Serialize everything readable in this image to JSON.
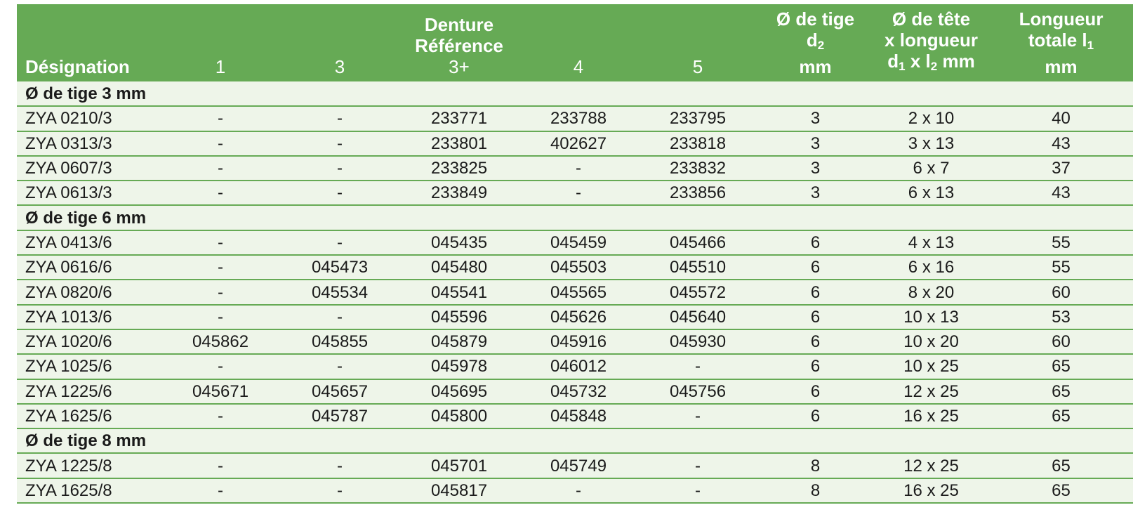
{
  "header": {
    "designation": "Désignation",
    "col1": "1",
    "col3": "3",
    "denture_line1": "Denture",
    "denture_line2": "Référence",
    "col3plus": "3+",
    "col4": "4",
    "col5": "5",
    "tige_line1": "Ø de tige",
    "tige_line2_base": "d",
    "tige_line2_sub": "2",
    "tige_line3": "mm",
    "tete_line1": "Ø de tête",
    "tete_line2": "x longueur",
    "tete_line3_d": "d",
    "tete_line3_d_sub": "1",
    "tete_line3_x": " x l",
    "tete_line3_l_sub": "2",
    "tete_line3_mm": " mm",
    "longueur_line1": "Longueur",
    "longueur_line2_base": "totale l",
    "longueur_line2_sub": "1",
    "longueur_line3": "mm"
  },
  "groups": [
    {
      "label": "Ø de tige 3 mm",
      "rows": [
        {
          "des": "ZYA 0210/3",
          "c1": "-",
          "c3": "-",
          "c3p": "233771",
          "c4": "233788",
          "c5": "233795",
          "d2": "3",
          "tete": "2 x 10",
          "long": "40"
        },
        {
          "des": "ZYA 0313/3",
          "c1": "-",
          "c3": "-",
          "c3p": "233801",
          "c4": "402627",
          "c5": "233818",
          "d2": "3",
          "tete": "3 x 13",
          "long": "43"
        },
        {
          "des": "ZYA 0607/3",
          "c1": "-",
          "c3": "-",
          "c3p": "233825",
          "c4": "-",
          "c5": "233832",
          "d2": "3",
          "tete": "6 x 7",
          "long": "37"
        },
        {
          "des": "ZYA 0613/3",
          "c1": "-",
          "c3": "-",
          "c3p": "233849",
          "c4": "-",
          "c5": "233856",
          "d2": "3",
          "tete": "6 x 13",
          "long": "43"
        }
      ]
    },
    {
      "label": "Ø de tige 6 mm",
      "rows": [
        {
          "des": "ZYA 0413/6",
          "c1": "-",
          "c3": "-",
          "c3p": "045435",
          "c4": "045459",
          "c5": "045466",
          "d2": "6",
          "tete": "4 x 13",
          "long": "55"
        },
        {
          "des": "ZYA 0616/6",
          "c1": "-",
          "c3": "045473",
          "c3p": "045480",
          "c4": "045503",
          "c5": "045510",
          "d2": "6",
          "tete": "6 x 16",
          "long": "55"
        },
        {
          "des": "ZYA 0820/6",
          "c1": "-",
          "c3": "045534",
          "c3p": "045541",
          "c4": "045565",
          "c5": "045572",
          "d2": "6",
          "tete": "8 x 20",
          "long": "60"
        },
        {
          "des": "ZYA 1013/6",
          "c1": "-",
          "c3": "-",
          "c3p": "045596",
          "c4": "045626",
          "c5": "045640",
          "d2": "6",
          "tete": "10 x 13",
          "long": "53"
        },
        {
          "des": "ZYA 1020/6",
          "c1": "045862",
          "c3": "045855",
          "c3p": "045879",
          "c4": "045916",
          "c5": "045930",
          "d2": "6",
          "tete": "10 x 20",
          "long": "60"
        },
        {
          "des": "ZYA 1025/6",
          "c1": "-",
          "c3": "-",
          "c3p": "045978",
          "c4": "046012",
          "c5": "-",
          "d2": "6",
          "tete": "10 x 25",
          "long": "65"
        },
        {
          "des": "ZYA 1225/6",
          "c1": "045671",
          "c3": "045657",
          "c3p": "045695",
          "c4": "045732",
          "c5": "045756",
          "d2": "6",
          "tete": "12 x 25",
          "long": "65"
        },
        {
          "des": "ZYA 1625/6",
          "c1": "-",
          "c3": "045787",
          "c3p": "045800",
          "c4": "045848",
          "c5": "-",
          "d2": "6",
          "tete": "16 x 25",
          "long": "65"
        }
      ]
    },
    {
      "label": "Ø de tige 8 mm",
      "rows": [
        {
          "des": "ZYA 1225/8",
          "c1": "-",
          "c3": "-",
          "c3p": "045701",
          "c4": "045749",
          "c5": "-",
          "d2": "8",
          "tete": "12 x 25",
          "long": "65"
        },
        {
          "des": "ZYA 1625/8",
          "c1": "-",
          "c3": "-",
          "c3p": "045817",
          "c4": "-",
          "c5": "-",
          "d2": "8",
          "tete": "16 x 25",
          "long": "65"
        }
      ]
    }
  ],
  "colors": {
    "header_bg": "#66aa55",
    "row_bg": "#eef5e9",
    "rule": "#66aa55"
  }
}
